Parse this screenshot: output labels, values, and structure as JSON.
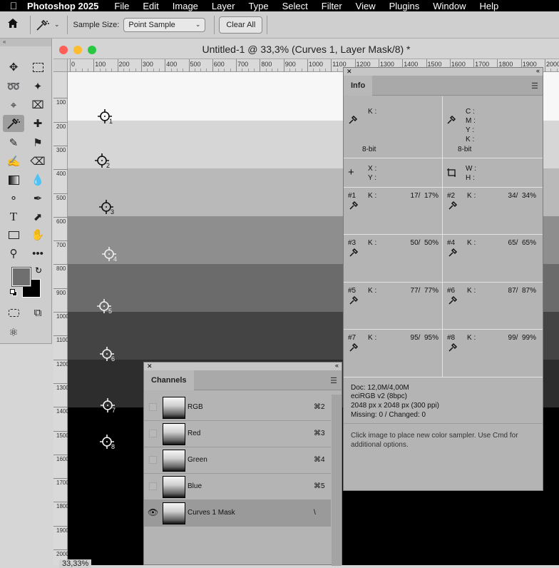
{
  "menubar": {
    "app": "Photoshop 2025",
    "items": [
      "File",
      "Edit",
      "Image",
      "Layer",
      "Type",
      "Select",
      "Filter",
      "View",
      "Plugins",
      "Window",
      "Help"
    ]
  },
  "options": {
    "sample_size_label": "Sample Size:",
    "sample_size_value": "Point Sample",
    "clear_all": "Clear All"
  },
  "document": {
    "title": "Untitled-1 @ 33,3% (Curves 1, Layer Mask/8) *",
    "ruler_labels": [
      "0",
      "100",
      "200",
      "300",
      "400",
      "500",
      "600",
      "700",
      "800",
      "900",
      "1000",
      "1100",
      "1200",
      "1300",
      "1400",
      "1500",
      "1600",
      "1700",
      "1800",
      "1900",
      "2000"
    ],
    "vruler_labels": [
      "100",
      "200",
      "300",
      "400",
      "500",
      "600",
      "700",
      "800",
      "900",
      "1000",
      "1100",
      "1200",
      "1300",
      "1400",
      "1500",
      "1600",
      "1700",
      "1800",
      "1900",
      "2000"
    ],
    "bands": [
      "#f7f7f7",
      "#d6d6d6",
      "#b9b9b9",
      "#8e8e8e",
      "#6b6b6b",
      "#444444",
      "#2d2d2d",
      "#000000"
    ],
    "samplers": [
      "1",
      "2",
      "3",
      "4",
      "5",
      "6",
      "7",
      "8"
    ],
    "zoom_status": "33,33%"
  },
  "info_panel": {
    "tab": "Info",
    "k_label": "K :",
    "c_label": "C :",
    "m_label": "M :",
    "y_label": "Y :",
    "bit_left": "8-bit",
    "bit_right": "8-bit",
    "x_label": "X :",
    "y_coord_label": "Y :",
    "w_label": "W :",
    "h_label": "H :",
    "samplers": [
      {
        "id": "#1",
        "k": "K :",
        "value": "17/  17%"
      },
      {
        "id": "#2",
        "k": "K :",
        "value": "34/  34%"
      },
      {
        "id": "#3",
        "k": "K :",
        "value": "50/  50%"
      },
      {
        "id": "#4",
        "k": "K :",
        "value": "65/  65%"
      },
      {
        "id": "#5",
        "k": "K :",
        "value": "77/  77%"
      },
      {
        "id": "#6",
        "k": "K :",
        "value": "87/  87%"
      },
      {
        "id": "#7",
        "k": "K :",
        "value": "95/  95%"
      },
      {
        "id": "#8",
        "k": "K :",
        "value": "99/  99%"
      }
    ],
    "doc": "Doc: 12,0M/4,00M",
    "profile": "eciRGB v2 (8bpc)",
    "dimensions": "2048 px x 2048 px (300 ppi)",
    "missing": "Missing: 0 / Changed: 0",
    "hint": "Click image to place new color sampler.  Use Cmd for additional options."
  },
  "channels_panel": {
    "tab": "Channels",
    "rows": [
      {
        "name": "RGB",
        "shortcut": "⌘2"
      },
      {
        "name": "Red",
        "shortcut": "⌘3"
      },
      {
        "name": "Green",
        "shortcut": "⌘4"
      },
      {
        "name": "Blue",
        "shortcut": "⌘5"
      },
      {
        "name": "Curves 1 Mask",
        "shortcut": "\\"
      }
    ]
  }
}
